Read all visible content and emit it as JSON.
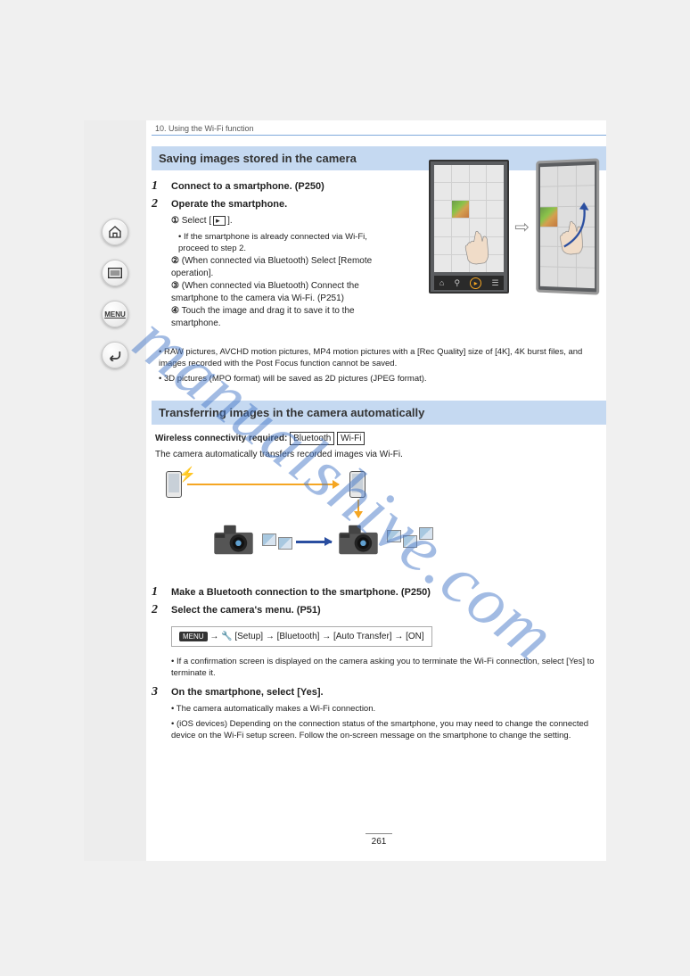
{
  "chapter": "10. Using the Wi-Fi function",
  "section1": {
    "title": "Saving images stored in the camera",
    "step1_num": "1",
    "step1": "Connect to a smartphone. (P250)",
    "step2_num": "2",
    "step2": "Operate the smartphone.",
    "sub1_num": "1",
    "sub1": " Select [      ].",
    "sub1_extra": "If the smartphone is already connected via Wi-Fi, proceed to step 2.",
    "sub2_num": "2",
    "sub2": "(When connected via Bluetooth) Select [Remote operation].",
    "sub3_num": "3",
    "sub3": "(When connected via Bluetooth) Connect the smartphone to the camera via Wi-Fi. (P251)",
    "sub4_num": "4",
    "sub4": "Touch the image and drag it to save it to the smartphone.",
    "note1": "RAW pictures, AVCHD motion pictures, MP4 motion pictures with a [Rec Quality] size of [4K], 4K burst files, and images recorded with the Post Focus function cannot be saved.",
    "note2": "3D pictures (MPO format) will be saved as 2D pictures (JPEG format)."
  },
  "section2": {
    "title": "Transferring images in the camera automatically",
    "label": "Wireless connectivity required:    Bluetooth    Wi-Fi",
    "desc": "The camera automatically transfers recorded images via Wi-Fi.",
    "step1_num": "1",
    "step1": "Make a Bluetooth connection to the smartphone. (P250)",
    "step2_num": "2",
    "step2": "Select the camera's menu. (P51)",
    "menu_path": "MENU → [Setup] → [Bluetooth] → [Auto Transfer] → [ON]",
    "menu_note": "If a confirmation screen is displayed on the camera asking you to terminate the Wi-Fi connection, select [Yes] to terminate it.",
    "step3_num": "3",
    "step3": "On the smartphone, select [Yes].",
    "step3_note1": "The camera automatically makes a Wi-Fi connection.",
    "step3_note2": "(iOS devices) Depending on the connection status of the smartphone, you may need to change the connected device on the Wi-Fi setup screen. Follow the on-screen message on the smartphone to change the setting."
  },
  "page_number": "261",
  "watermark": "manualshive.com",
  "nav": {
    "home": "home",
    "list": "list",
    "menu": "MENU",
    "back": "back"
  }
}
